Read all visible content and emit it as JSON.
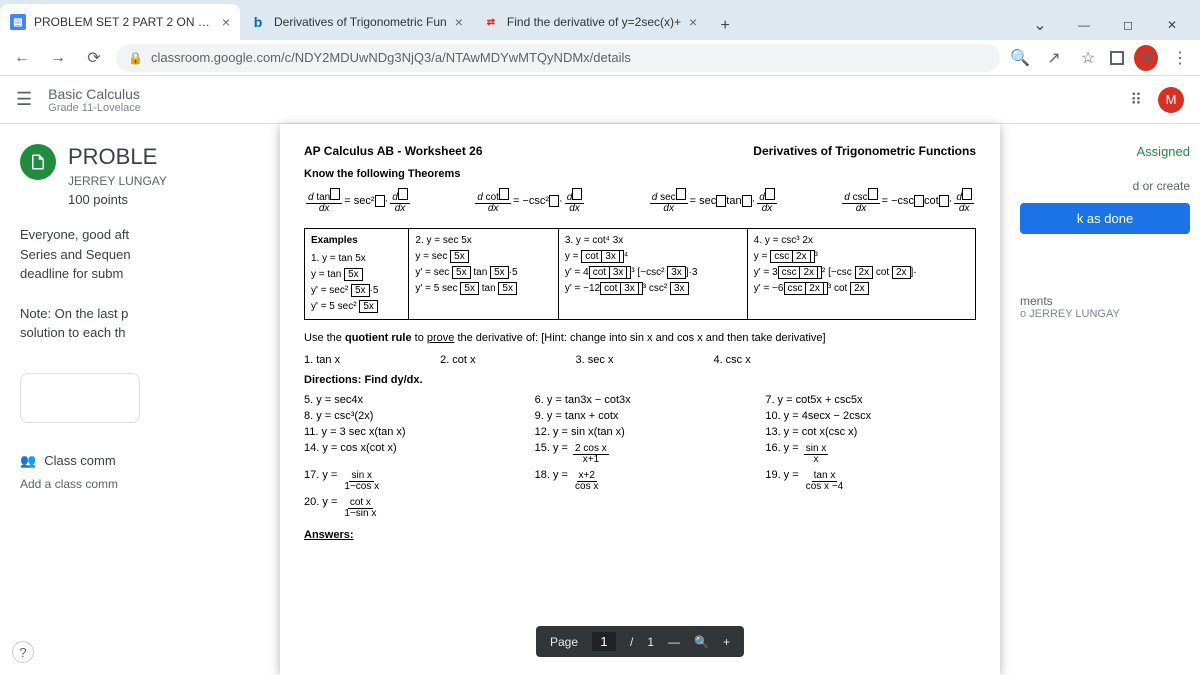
{
  "tabs": [
    {
      "label": "PROBLEM SET 2 PART 2 ON DER",
      "favicon": "classroom"
    },
    {
      "label": "Derivatives of Trigonometric Fun",
      "favicon": "b"
    },
    {
      "label": "Find the derivative of y=2sec(x)+",
      "favicon": "symbolab"
    }
  ],
  "url": "classroom.google.com/c/NDY2MDUwNDg3NjQ3/a/NTAwMDYwMTQyNDMx/details",
  "classroom": {
    "title": "Basic Calculus",
    "section": "Grade 11-Lovelace",
    "avatar": "M"
  },
  "assignment": {
    "title_visible": "PROBLE",
    "author": "JERREY LUNGAY",
    "points": "100 points",
    "desc1": "Everyone, good aft",
    "desc2": "Series and Sequen",
    "desc3": "deadline for subm",
    "note1": "Note: On the last p",
    "note2": "solution to each th",
    "class_comments": "Class comm",
    "add_comment": "Add a class comm"
  },
  "sidebar": {
    "assigned": "Assigned",
    "add_create": "d or create",
    "mark_done": "k as done",
    "private_label": "ments",
    "private_to": "o JERREY LUNGAY"
  },
  "document": {
    "title_left": "AP Calculus AB - Worksheet 26",
    "title_right": "Derivatives of Trigonometric Functions",
    "subhead": "Know the following Theorems",
    "examples_label": "Examples",
    "ex1": "1. y = tan 5x",
    "ex2": "2. y = sec 5x",
    "ex3": "3. y = cot⁴ 3x",
    "ex4": "4. y = csc³ 2x",
    "quotient_text": "Use the quotient rule to prove the derivative of: [Hint: change into sin x and cos x and then take derivative]",
    "q1": "1. tan x",
    "q2": "2. cot x",
    "q3": "3. sec x",
    "q4": "4. csc x",
    "directions": "Directions:  Find dy/dx.",
    "p5": "5. y = sec4x",
    "p6": "6. y = tan3x − cot3x",
    "p7": "7. y = cot5x + csc5x",
    "p8": "8. y = csc³(2x)",
    "p9": "9. y = tanx + cotx",
    "p10": "10. y = 4secx − 2cscx",
    "p11": "11. y = 3 sec x(tan x)",
    "p12": "12. y = sin x(tan x)",
    "p13": "13. y = cot x(csc x)",
    "p14": "14. y = cos x(cot x)",
    "answers": "Answers:"
  },
  "pdf": {
    "page_label": "Page",
    "page": "1",
    "total": "1"
  }
}
